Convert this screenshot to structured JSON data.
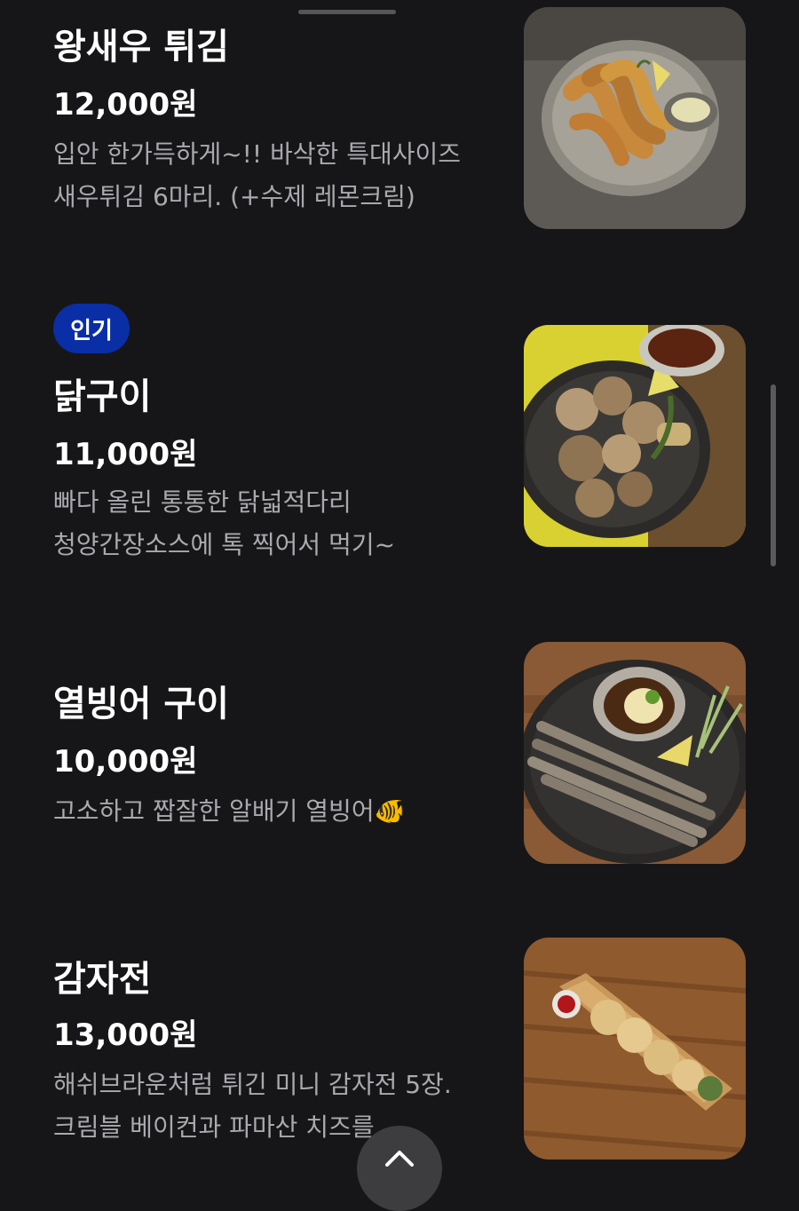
{
  "menu": {
    "items": [
      {
        "name": "왕새우 튀김",
        "price": "12,000원",
        "badge": "",
        "description": [
          "입안 한가득하게~!! 바삭한 특대사이즈",
          "새우튀김 6마리. (+수제 레몬크림)"
        ],
        "image": "fried-shrimp-photo"
      },
      {
        "name": "닭구이",
        "price": "11,000원",
        "badge": "인기",
        "description": [
          "빠다 올린 통통한 닭넓적다리",
          "청양간장소스에 톡 찍어서 먹기~"
        ],
        "image": "grilled-chicken-photo"
      },
      {
        "name": "열빙어 구이",
        "price": "10,000원",
        "badge": "",
        "description": [
          "고소하고 짭잘한 알배기 열빙어🐠"
        ],
        "image": "grilled-smelt-photo"
      },
      {
        "name": "감자전",
        "price": "13,000원",
        "badge": "",
        "description": [
          "해쉬브라운처럼 튀긴 미니 감자전 5장.",
          "크림블 베이컨과 파마산 치즈를"
        ],
        "image": "potato-pancake-photo"
      }
    ]
  },
  "controls": {
    "scroll_top_icon": "chevron-up-icon",
    "sheet_handle": "drag-handle"
  },
  "colors": {
    "background": "#161618",
    "badge": "#0a2ea5",
    "description": "#a9a9ae",
    "text": "#ffffff"
  }
}
